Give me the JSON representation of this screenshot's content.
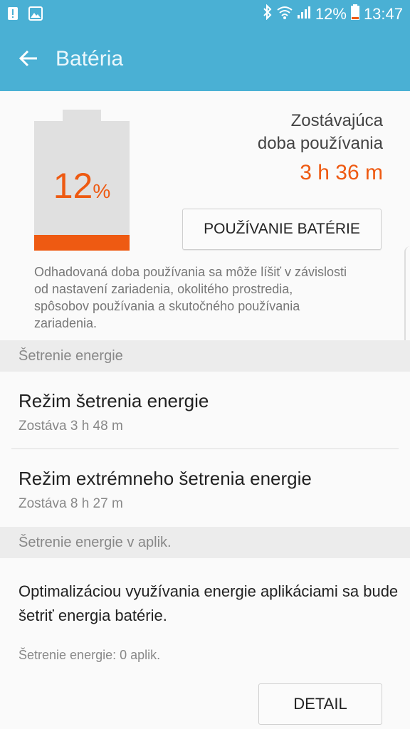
{
  "status_bar": {
    "battery_pct": "12%",
    "time": "13:47",
    "icons": [
      "alert-icon",
      "image-icon",
      "bluetooth-icon",
      "wifi-icon",
      "signal-icon",
      "battery-icon"
    ]
  },
  "app_bar": {
    "title": "Batéria",
    "back_icon": "arrow-left-icon"
  },
  "battery": {
    "level": 0.12,
    "percent_number": "12",
    "percent_symbol": "%",
    "remaining_label_line1": "Zostávajúca",
    "remaining_label_line2": "doba používania",
    "remaining_value": "3 h 36 m",
    "usage_button": "POUŽÍVANIE BATÉRIE",
    "note": "Odhadovaná doba používania sa môže líšiť v závislosti od nastavení zariadenia, okolitého prostredia, spôsobov používania a skutočného používania zariadenia."
  },
  "power_saving": {
    "header": "Šetrenie energie",
    "items": [
      {
        "title": "Režim šetrenia energie",
        "subtitle": "Zostáva 3 h 48 m"
      },
      {
        "title": "Režim extrémneho šetrenia energie",
        "subtitle": "Zostáva 8 h 27 m"
      }
    ]
  },
  "app_power_saving": {
    "header": "Šetrenie energie v aplik.",
    "description": "Optimalizáciou využívania energie aplikáciami sa bude šetriť energia batérie.",
    "count": "Šetrenie energie: 0 aplik.",
    "detail_button": "DETAIL"
  },
  "colors": {
    "accent": "#4ab0d4",
    "battery_orange": "#ee5a12"
  }
}
